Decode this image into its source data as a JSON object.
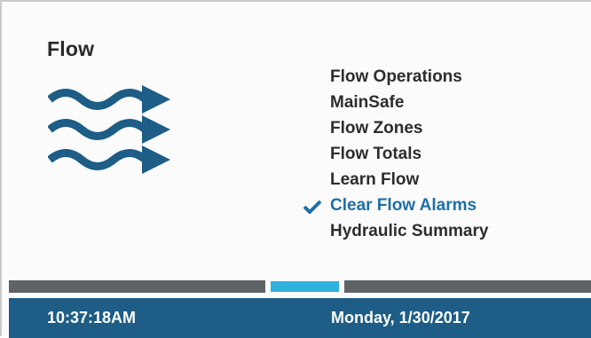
{
  "screen": {
    "title": "Flow",
    "icon": "flow-waves-icon"
  },
  "menu": {
    "items": [
      {
        "label": "Flow Operations",
        "selected": false
      },
      {
        "label": "MainSafe",
        "selected": false
      },
      {
        "label": "Flow Zones",
        "selected": false
      },
      {
        "label": "Flow Totals",
        "selected": false
      },
      {
        "label": "Learn Flow",
        "selected": false
      },
      {
        "label": "Clear Flow Alarms",
        "selected": true
      },
      {
        "label": "Hydraulic Summary",
        "selected": false
      }
    ],
    "selected_icon": "checkmark-icon"
  },
  "pager": {
    "page_count": 3,
    "active_page": 2
  },
  "status": {
    "time": "10:37:18AM",
    "date": "Monday, 1/30/2017"
  },
  "colors": {
    "accent": "#1f6fa6",
    "status_bar": "#1d5d86",
    "pager_active": "#30b0dc",
    "pager_inactive": "#5e6367",
    "icon": "#1d5d86"
  }
}
